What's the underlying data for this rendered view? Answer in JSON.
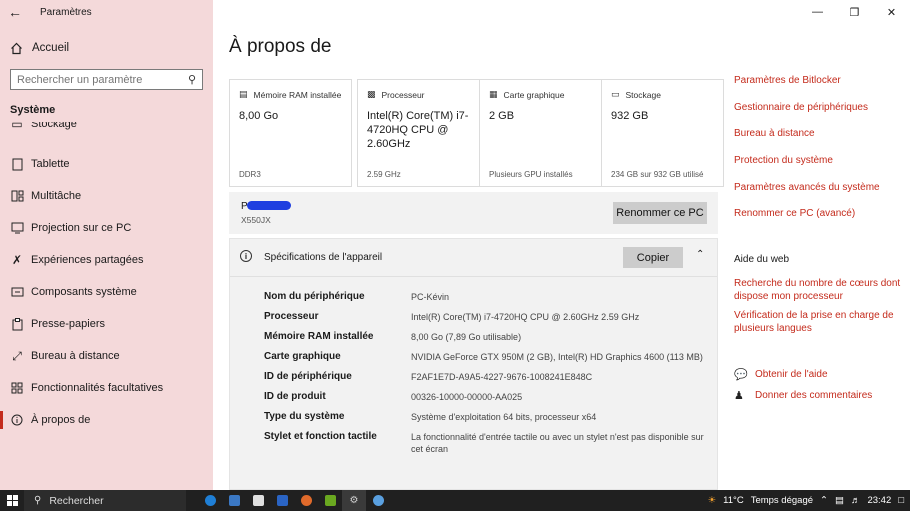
{
  "window": {
    "title": "Paramètres",
    "minimize": "—",
    "maximize": "❐",
    "close": "✕"
  },
  "sidebar": {
    "home_label": "Accueil",
    "search_placeholder": "Rechercher un paramètre",
    "section_title": "Système",
    "items": [
      {
        "label": "Stockage",
        "icon": "storage-icon"
      },
      {
        "label": "Tablette",
        "icon": "tablet-icon"
      },
      {
        "label": "Multitâche",
        "icon": "multitask-icon"
      },
      {
        "label": "Projection sur ce PC",
        "icon": "projection-icon"
      },
      {
        "label": "Expériences partagées",
        "icon": "shared-icon"
      },
      {
        "label": "Composants système",
        "icon": "components-icon"
      },
      {
        "label": "Presse-papiers",
        "icon": "clipboard-icon"
      },
      {
        "label": "Bureau à distance",
        "icon": "remote-desktop-icon"
      },
      {
        "label": "Fonctionnalités facultatives",
        "icon": "optional-features-icon"
      },
      {
        "label": "À propos de",
        "icon": "info-icon"
      }
    ]
  },
  "main": {
    "page_title": "À propos de",
    "cards": [
      {
        "header": "Mémoire RAM installée",
        "value": "8,00 Go",
        "sub": "DDR3",
        "icon": "ram-icon"
      },
      {
        "header": "Processeur",
        "value": "Intel(R) Core(TM) i7-4720HQ CPU @ 2.60GHz",
        "sub": "2.59 GHz",
        "icon": "cpu-icon"
      },
      {
        "header": "Carte graphique",
        "value": "2 GB",
        "sub": "Plusieurs GPU installés",
        "icon": "gpu-icon"
      },
      {
        "header": "Stockage",
        "value": "932 GB",
        "sub": "234 GB sur 932 GB utilisé",
        "icon": "storage-icon"
      }
    ],
    "pc": {
      "name": "PC",
      "model": "X550JX",
      "rename_label": "Renommer ce PC"
    },
    "specs": {
      "title": "Spécifications de l'appareil",
      "copy_label": "Copier",
      "rows": [
        {
          "key": "Nom du périphérique",
          "value": "PC-Kévin"
        },
        {
          "key": "Processeur",
          "value": "Intel(R) Core(TM) i7-4720HQ CPU @ 2.60GHz   2.59 GHz"
        },
        {
          "key": "Mémoire RAM installée",
          "value": "8,00 Go (7,89 Go utilisable)"
        },
        {
          "key": "Carte graphique",
          "value": "NVIDIA GeForce GTX 950M (2 GB), Intel(R) HD Graphics 4600 (113 MB)"
        },
        {
          "key": "ID de périphérique",
          "value": "F2AF1E7D-A9A5-4227-9676-1008241E848C"
        },
        {
          "key": "ID de produit",
          "value": "00326-10000-00000-AA025"
        },
        {
          "key": "Type du système",
          "value": "Système d'exploitation 64 bits, processeur x64"
        },
        {
          "key": "Stylet et fonction tactile",
          "value": "La fonctionnalité d'entrée tactile ou avec un stylet n'est pas disponible sur cet écran"
        }
      ]
    }
  },
  "related": {
    "links": [
      "Paramètres de Bitlocker",
      "Gestionnaire de périphériques",
      "Bureau à distance",
      "Protection du système",
      "Paramètres avancés du système",
      "Renommer ce PC (avancé)"
    ],
    "web_title": "Aide du web",
    "web_links": [
      "Recherche du nombre de cœurs dont dispose mon processeur",
      "Vérification de la prise en charge de plusieurs langues"
    ],
    "help_label": "Obtenir de l'aide",
    "feedback_label": "Donner des commentaires"
  },
  "taskbar": {
    "search_label": "Rechercher",
    "temperature": "11°C",
    "weather": "Temps dégagé",
    "time": "23:42",
    "icon_colors": [
      "#1f7fd6",
      "#3b78c4",
      "#e0e0e0",
      "#2a64c4",
      "#e06a2b",
      "#6aa820",
      "#cfcfcf",
      "#5aa0e0"
    ]
  },
  "colors": {
    "accent": "#c42b1c",
    "sidebar_bg": "#f4d9da"
  }
}
